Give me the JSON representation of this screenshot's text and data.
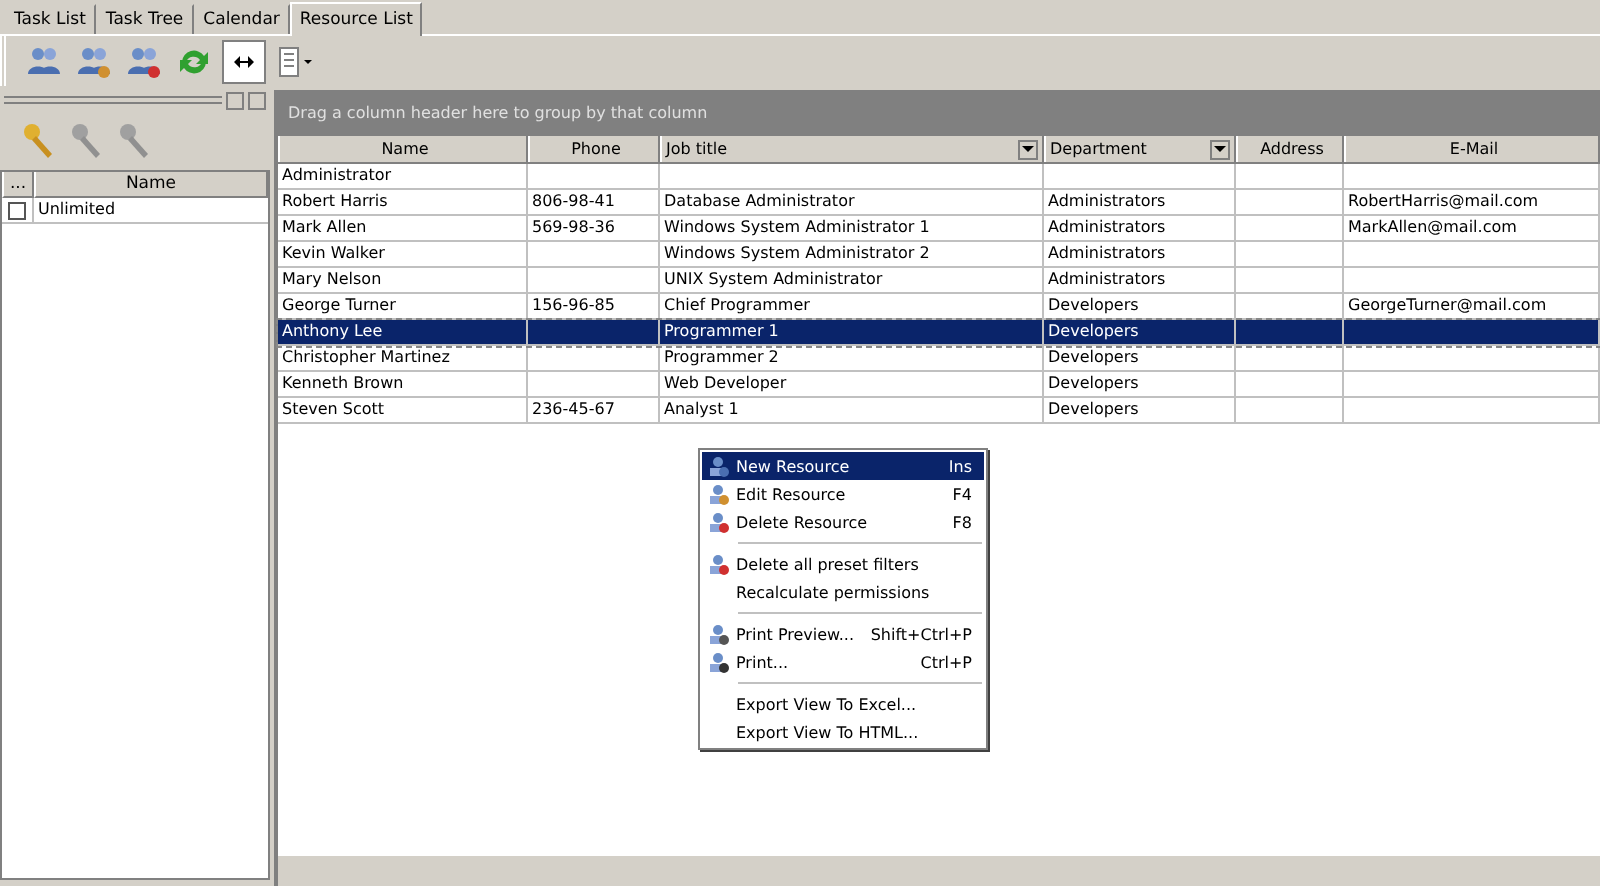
{
  "tabs": [
    {
      "label": "Task List",
      "selected": false
    },
    {
      "label": "Task Tree",
      "selected": false
    },
    {
      "label": "Calendar",
      "selected": false
    },
    {
      "label": "Resource List",
      "selected": true
    }
  ],
  "left_panel": {
    "columns": [
      "...",
      "Name"
    ],
    "rows": [
      {
        "checked": false,
        "name": "Unlimited"
      }
    ]
  },
  "grid": {
    "group_hint": "Drag a column header here to group by that column",
    "columns": [
      {
        "label": "Name",
        "filter": false
      },
      {
        "label": "Phone",
        "filter": false
      },
      {
        "label": "Job title",
        "filter": true
      },
      {
        "label": "Department",
        "filter": true
      },
      {
        "label": "Address",
        "filter": false
      },
      {
        "label": "E-Mail",
        "filter": false
      }
    ],
    "rows": [
      {
        "selected": false,
        "cells": [
          "Administrator",
          "",
          "",
          "",
          "",
          ""
        ]
      },
      {
        "selected": false,
        "cells": [
          "Robert Harris",
          "806-98-41",
          "Database Administrator",
          "Administrators",
          "",
          "RobertHarris@mail.com"
        ]
      },
      {
        "selected": false,
        "cells": [
          "Mark Allen",
          "569-98-36",
          "Windows System Administrator 1",
          "Administrators",
          "",
          "MarkAllen@mail.com"
        ]
      },
      {
        "selected": false,
        "cells": [
          "Kevin Walker",
          "",
          "Windows System Administrator 2",
          "Administrators",
          "",
          ""
        ]
      },
      {
        "selected": false,
        "cells": [
          "Mary Nelson",
          "",
          "UNIX System Administrator",
          "Administrators",
          "",
          ""
        ]
      },
      {
        "selected": false,
        "cells": [
          "George Turner",
          "156-96-85",
          "Chief Programmer",
          "Developers",
          "",
          "GeorgeTurner@mail.com"
        ]
      },
      {
        "selected": true,
        "cells": [
          "Anthony Lee",
          "",
          "Programmer 1",
          "Developers",
          "",
          ""
        ]
      },
      {
        "selected": false,
        "cells": [
          "Christopher Martinez",
          "",
          "Programmer 2",
          "Developers",
          "",
          ""
        ]
      },
      {
        "selected": false,
        "cells": [
          "Kenneth Brown",
          "",
          "Web Developer",
          "Developers",
          "",
          ""
        ]
      },
      {
        "selected": false,
        "cells": [
          "Steven Scott",
          "236-45-67",
          "Analyst 1",
          "Developers",
          "",
          ""
        ]
      }
    ]
  },
  "context_menu": [
    {
      "kind": "item",
      "label": "New Resource",
      "shortcut": "Ins",
      "selected": true
    },
    {
      "kind": "item",
      "label": "Edit Resource",
      "shortcut": "F4",
      "selected": false
    },
    {
      "kind": "item",
      "label": "Delete Resource",
      "shortcut": "F8",
      "selected": false
    },
    {
      "kind": "separator"
    },
    {
      "kind": "item",
      "label": "Delete all preset filters",
      "selected": false
    },
    {
      "kind": "item",
      "label": "Recalculate permissions",
      "selected": false
    },
    {
      "kind": "separator"
    },
    {
      "kind": "item",
      "label": "Print Preview...",
      "shortcut": "Shift+Ctrl+P",
      "selected": false
    },
    {
      "kind": "item",
      "label": "Print...",
      "shortcut": "Ctrl+P",
      "selected": false
    },
    {
      "kind": "separator"
    },
    {
      "kind": "item",
      "label": "Export View To Excel...",
      "selected": false
    },
    {
      "kind": "item",
      "label": "Export View To HTML...",
      "selected": false
    }
  ]
}
